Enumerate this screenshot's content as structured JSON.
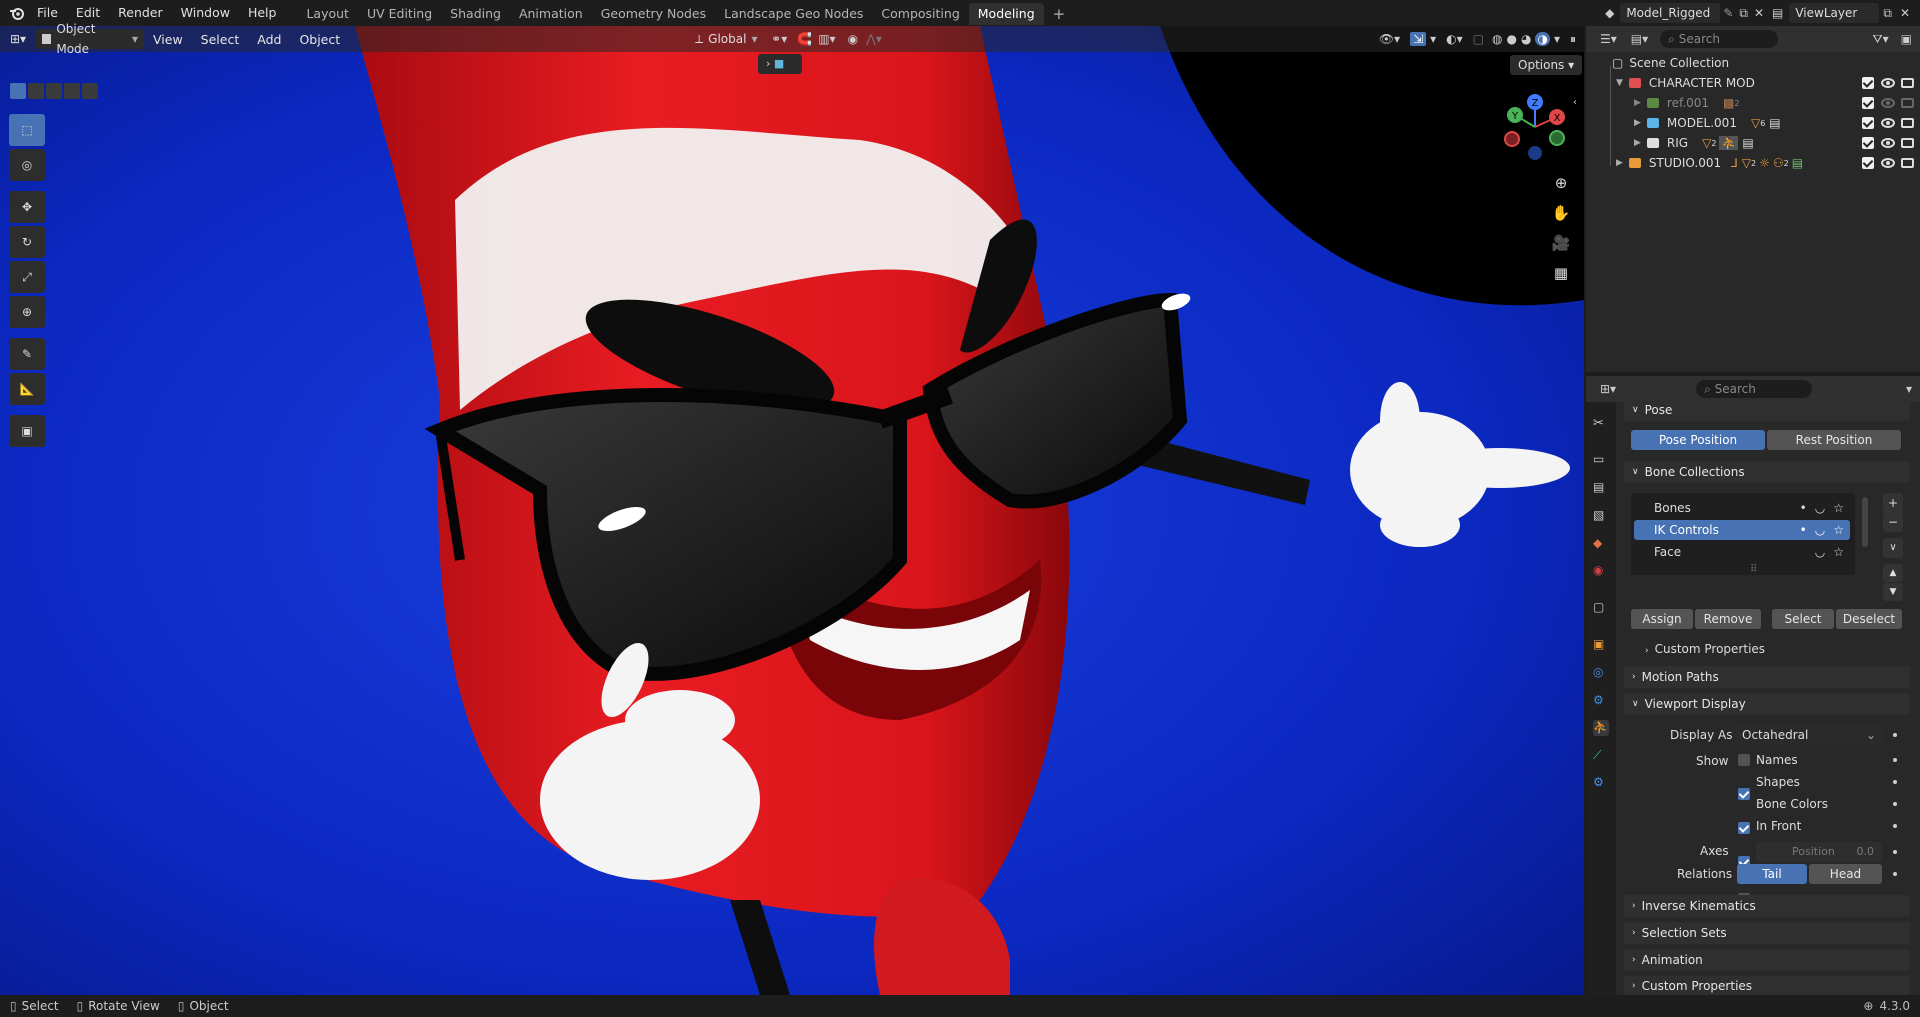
{
  "topbar": {
    "menus": [
      "File",
      "Edit",
      "Render",
      "Window",
      "Help"
    ],
    "workspaces": [
      "Layout",
      "UV Editing",
      "Shading",
      "Animation",
      "Geometry Nodes",
      "Landscape Geo Nodes",
      "Compositing",
      "Modeling"
    ],
    "active_workspace": "Modeling",
    "add_tab": "+",
    "scene_name": "Model_Rigged",
    "view_layer": "ViewLayer"
  },
  "viewport_header": {
    "mode": "Object Mode",
    "menus": [
      "View",
      "Select",
      "Add",
      "Object"
    ],
    "transform_orientation": "Global",
    "options_label": "Options"
  },
  "outliner": {
    "search_placeholder": "Search",
    "root": "Scene Collection",
    "items": [
      {
        "name": "CHARACTER MOD",
        "color": "#e05050"
      },
      {
        "name": "ref.001",
        "color": "#7fbf5a"
      },
      {
        "name": "MODEL.001",
        "color": "#5ab4e6"
      },
      {
        "name": "RIG",
        "color": "#dddddd"
      },
      {
        "name": "STUDIO.001",
        "color": "#e69a3a"
      }
    ],
    "badges": {
      "ref": "2",
      "model": "6",
      "rig": "2",
      "studio_a": "2",
      "studio_b": "2"
    }
  },
  "properties": {
    "search_placeholder": "Search",
    "pose_panel": {
      "title": "Pose",
      "pose_position": "Pose Position",
      "rest_position": "Rest Position",
      "active": "Pose Position"
    },
    "bone_collections": {
      "title": "Bone Collections",
      "items": [
        "Bones",
        "IK Controls",
        "Face"
      ],
      "selected": "IK Controls",
      "assign": "Assign",
      "remove": "Remove",
      "select": "Select",
      "deselect": "Deselect",
      "custom_properties": "Custom Properties",
      "add": "+",
      "remove_sym": "−"
    },
    "motion_paths": "Motion Paths",
    "viewport_display": {
      "title": "Viewport Display",
      "display_as_label": "Display As",
      "display_as_value": "Octahedral",
      "show_label": "Show",
      "names": {
        "label": "Names",
        "checked": false
      },
      "shapes": {
        "label": "Shapes",
        "checked": true
      },
      "bone_colors": {
        "label": "Bone Colors",
        "checked": true
      },
      "in_front": {
        "label": "In Front",
        "checked": true
      },
      "axes_label": "Axes",
      "position_label": "Position",
      "position_value": "0.0",
      "relations_label": "Relations",
      "tail": "Tail",
      "head": "Head",
      "relations_active": "Tail"
    },
    "collapsed_panels": [
      "Inverse Kinematics",
      "Selection Sets",
      "Animation",
      "Custom Properties"
    ]
  },
  "gizmo": {
    "x": "X",
    "y": "Y",
    "z": "Z"
  },
  "statusbar": {
    "select": "Select",
    "rotate": "Rotate View",
    "object": "Object",
    "version": "4.3.0"
  }
}
